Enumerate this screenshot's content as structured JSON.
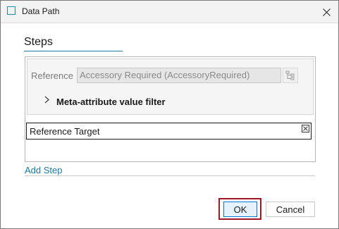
{
  "window": {
    "title": "Data Path",
    "accent": "#1a8fb4"
  },
  "section": {
    "title": "Steps"
  },
  "step": {
    "reference_label": "Reference",
    "reference_value": "Accessory Required (AccessoryRequired)",
    "filter_label": "Meta-attribute value filter"
  },
  "target": {
    "label": "Reference Target"
  },
  "actions": {
    "add_step": "Add Step",
    "ok": "OK",
    "cancel": "Cancel"
  },
  "colors": {
    "link": "#1a7aa8",
    "highlight": "#a01826",
    "ok_border": "#0078d4"
  }
}
